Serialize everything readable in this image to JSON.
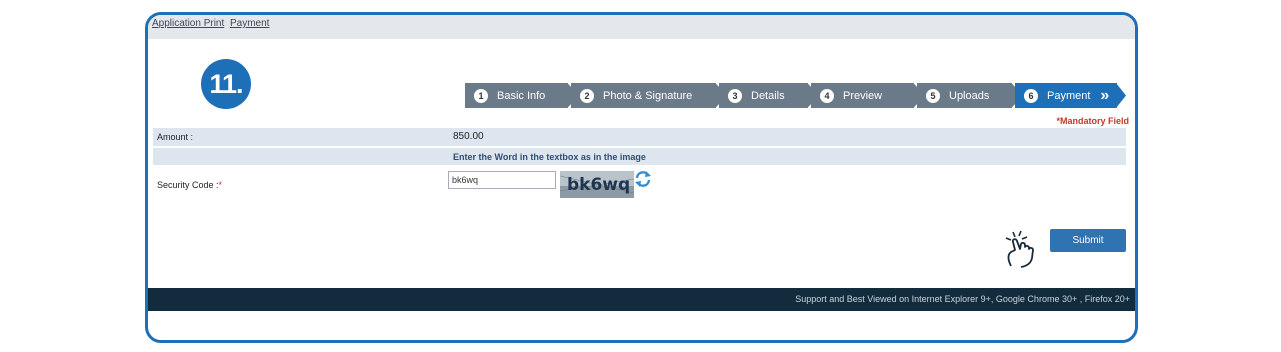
{
  "topnav": {
    "link1": "Application Print",
    "link2": "Payment"
  },
  "step_badge": "11.",
  "wizard": [
    {
      "num": "1",
      "label": "Basic Info"
    },
    {
      "num": "2",
      "label": "Photo & Signature"
    },
    {
      "num": "3",
      "label": "Details"
    },
    {
      "num": "4",
      "label": "Preview"
    },
    {
      "num": "5",
      "label": "Uploads"
    },
    {
      "num": "6",
      "label": "Payment",
      "active": true
    }
  ],
  "wizard_arrow": "»",
  "mandatory": "*Mandatory Field",
  "form": {
    "amount_label": "Amount :",
    "amount_value": "850.00",
    "hint": "Enter the Word in the textbox as in the image",
    "security_label": "Security Code :",
    "required_star": "*",
    "security_value": "bk6wq",
    "captcha_text": "bk6wq"
  },
  "submit_label": "Submit",
  "footer": "Support and Best Viewed on Internet Explorer 9+, Google Chrome 30+ , Firefox 20+",
  "colors": {
    "accent": "#1d6fb8",
    "wizard_inactive": "#6b7a89",
    "footer_bg": "#132c3d",
    "required": "#c0392b"
  }
}
